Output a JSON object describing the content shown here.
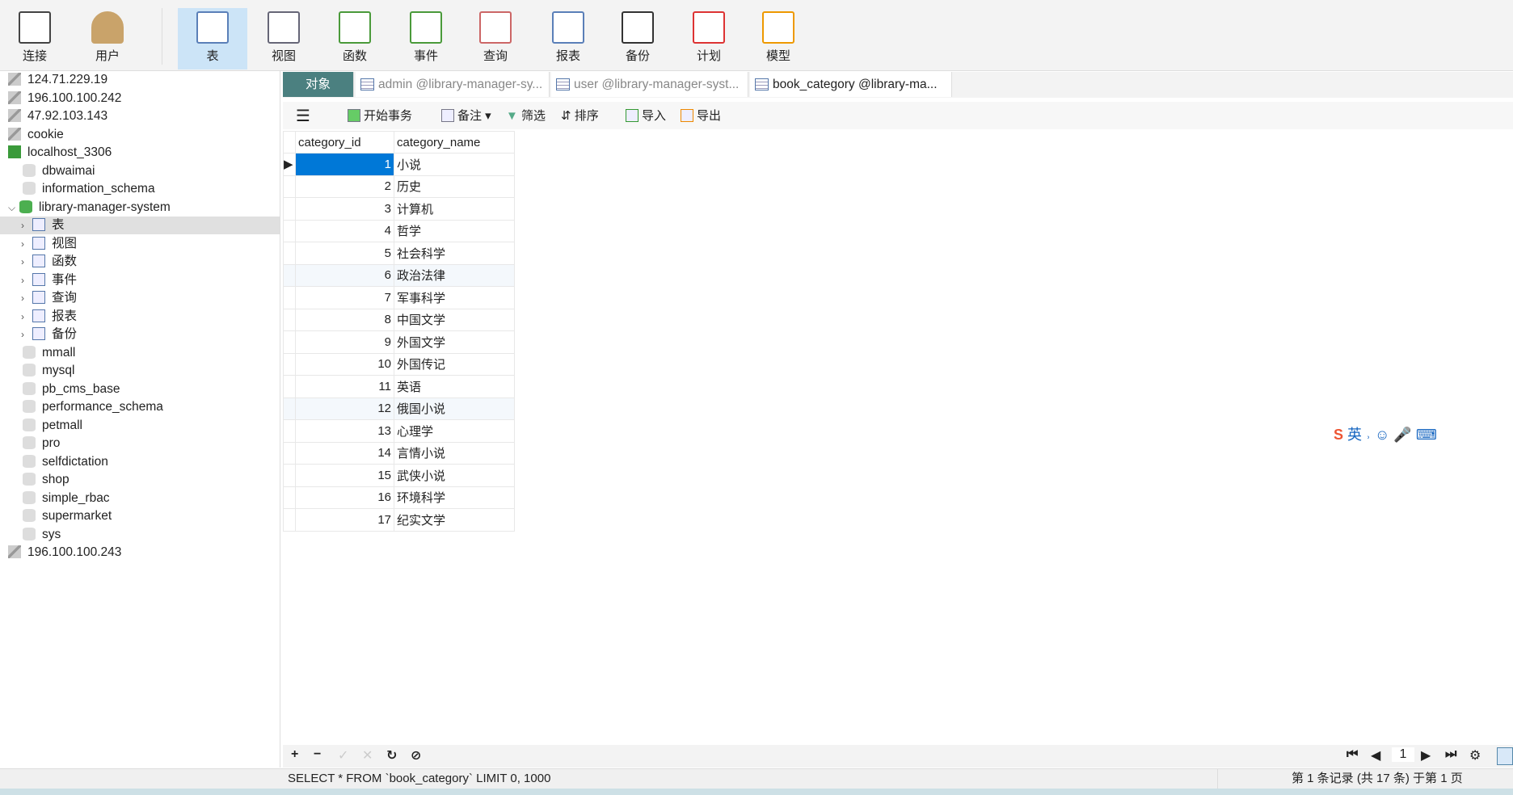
{
  "toolbar": {
    "items": [
      {
        "label": "连接",
        "icon": "plug-icon"
      },
      {
        "label": "用户",
        "icon": "user-icon"
      },
      {
        "label": "表",
        "icon": "table-icon",
        "active": true
      },
      {
        "label": "视图",
        "icon": "view-icon"
      },
      {
        "label": "函数",
        "icon": "function-icon"
      },
      {
        "label": "事件",
        "icon": "event-icon"
      },
      {
        "label": "查询",
        "icon": "query-icon"
      },
      {
        "label": "报表",
        "icon": "report-icon"
      },
      {
        "label": "备份",
        "icon": "backup-icon"
      },
      {
        "label": "计划",
        "icon": "schedule-icon"
      },
      {
        "label": "模型",
        "icon": "model-icon"
      }
    ]
  },
  "sidebar": {
    "nodes": [
      {
        "label": "124.71.229.19",
        "level": 0,
        "type": "server"
      },
      {
        "label": "196.100.100.242",
        "level": 0,
        "type": "server"
      },
      {
        "label": "47.92.103.143",
        "level": 0,
        "type": "server"
      },
      {
        "label": "cookie",
        "level": 0,
        "type": "server"
      },
      {
        "label": "localhost_3306",
        "level": 0,
        "type": "server-active"
      },
      {
        "label": "dbwaimai",
        "level": 1,
        "type": "db"
      },
      {
        "label": "information_schema",
        "level": 1,
        "type": "db"
      },
      {
        "label": "library-manager-system",
        "level": 1,
        "type": "db-open",
        "chev": "v"
      },
      {
        "label": "表",
        "level": 2,
        "type": "table",
        "chev": ">",
        "selected": true
      },
      {
        "label": "视图",
        "level": 2,
        "type": "view",
        "chev": ">"
      },
      {
        "label": "函数",
        "level": 2,
        "type": "function",
        "chev": ">"
      },
      {
        "label": "事件",
        "level": 2,
        "type": "event",
        "chev": ">"
      },
      {
        "label": "查询",
        "level": 2,
        "type": "query",
        "chev": ">"
      },
      {
        "label": "报表",
        "level": 2,
        "type": "report",
        "chev": ">"
      },
      {
        "label": "备份",
        "level": 2,
        "type": "backup",
        "chev": ">"
      },
      {
        "label": "mmall",
        "level": 1,
        "type": "db"
      },
      {
        "label": "mysql",
        "level": 1,
        "type": "db"
      },
      {
        "label": "pb_cms_base",
        "level": 1,
        "type": "db"
      },
      {
        "label": "performance_schema",
        "level": 1,
        "type": "db"
      },
      {
        "label": "petmall",
        "level": 1,
        "type": "db"
      },
      {
        "label": "pro",
        "level": 1,
        "type": "db"
      },
      {
        "label": "selfdictation",
        "level": 1,
        "type": "db"
      },
      {
        "label": "shop",
        "level": 1,
        "type": "db"
      },
      {
        "label": "simple_rbac",
        "level": 1,
        "type": "db"
      },
      {
        "label": "supermarket",
        "level": 1,
        "type": "db"
      },
      {
        "label": "sys",
        "level": 1,
        "type": "db"
      },
      {
        "label": "196.100.100.243",
        "level": 0,
        "type": "server"
      }
    ]
  },
  "tabs": [
    {
      "label": "对象"
    },
    {
      "label": "admin @library-manager-sy..."
    },
    {
      "label": "user @library-manager-syst..."
    },
    {
      "label": "book_category @library-ma..."
    }
  ],
  "objbar": {
    "begin": "开始事务",
    "note": "备注",
    "filter": "筛选",
    "sort": "排序",
    "import": "导入",
    "export": "导出"
  },
  "grid": {
    "columns": [
      "category_id",
      "category_name"
    ],
    "rows": [
      [
        1,
        "小说"
      ],
      [
        2,
        "历史"
      ],
      [
        3,
        "计算机"
      ],
      [
        4,
        "哲学"
      ],
      [
        5,
        "社会科学"
      ],
      [
        6,
        "政治法律"
      ],
      [
        7,
        "军事科学"
      ],
      [
        8,
        "中国文学"
      ],
      [
        9,
        "外国文学"
      ],
      [
        10,
        "外国传记"
      ],
      [
        11,
        "英语"
      ],
      [
        12,
        "俄国小说"
      ],
      [
        13,
        "心理学"
      ],
      [
        14,
        "言情小说"
      ],
      [
        15,
        "武侠小说"
      ],
      [
        16,
        "环境科学"
      ],
      [
        17,
        "纪实文学"
      ]
    ]
  },
  "pager": {
    "page": "1"
  },
  "status": {
    "sql": "SELECT * FROM `book_category` LIMIT 0, 1000",
    "records": "第 1 条记录 (共 17 条) 于第 1 页"
  },
  "ime": {
    "lang": "英"
  }
}
